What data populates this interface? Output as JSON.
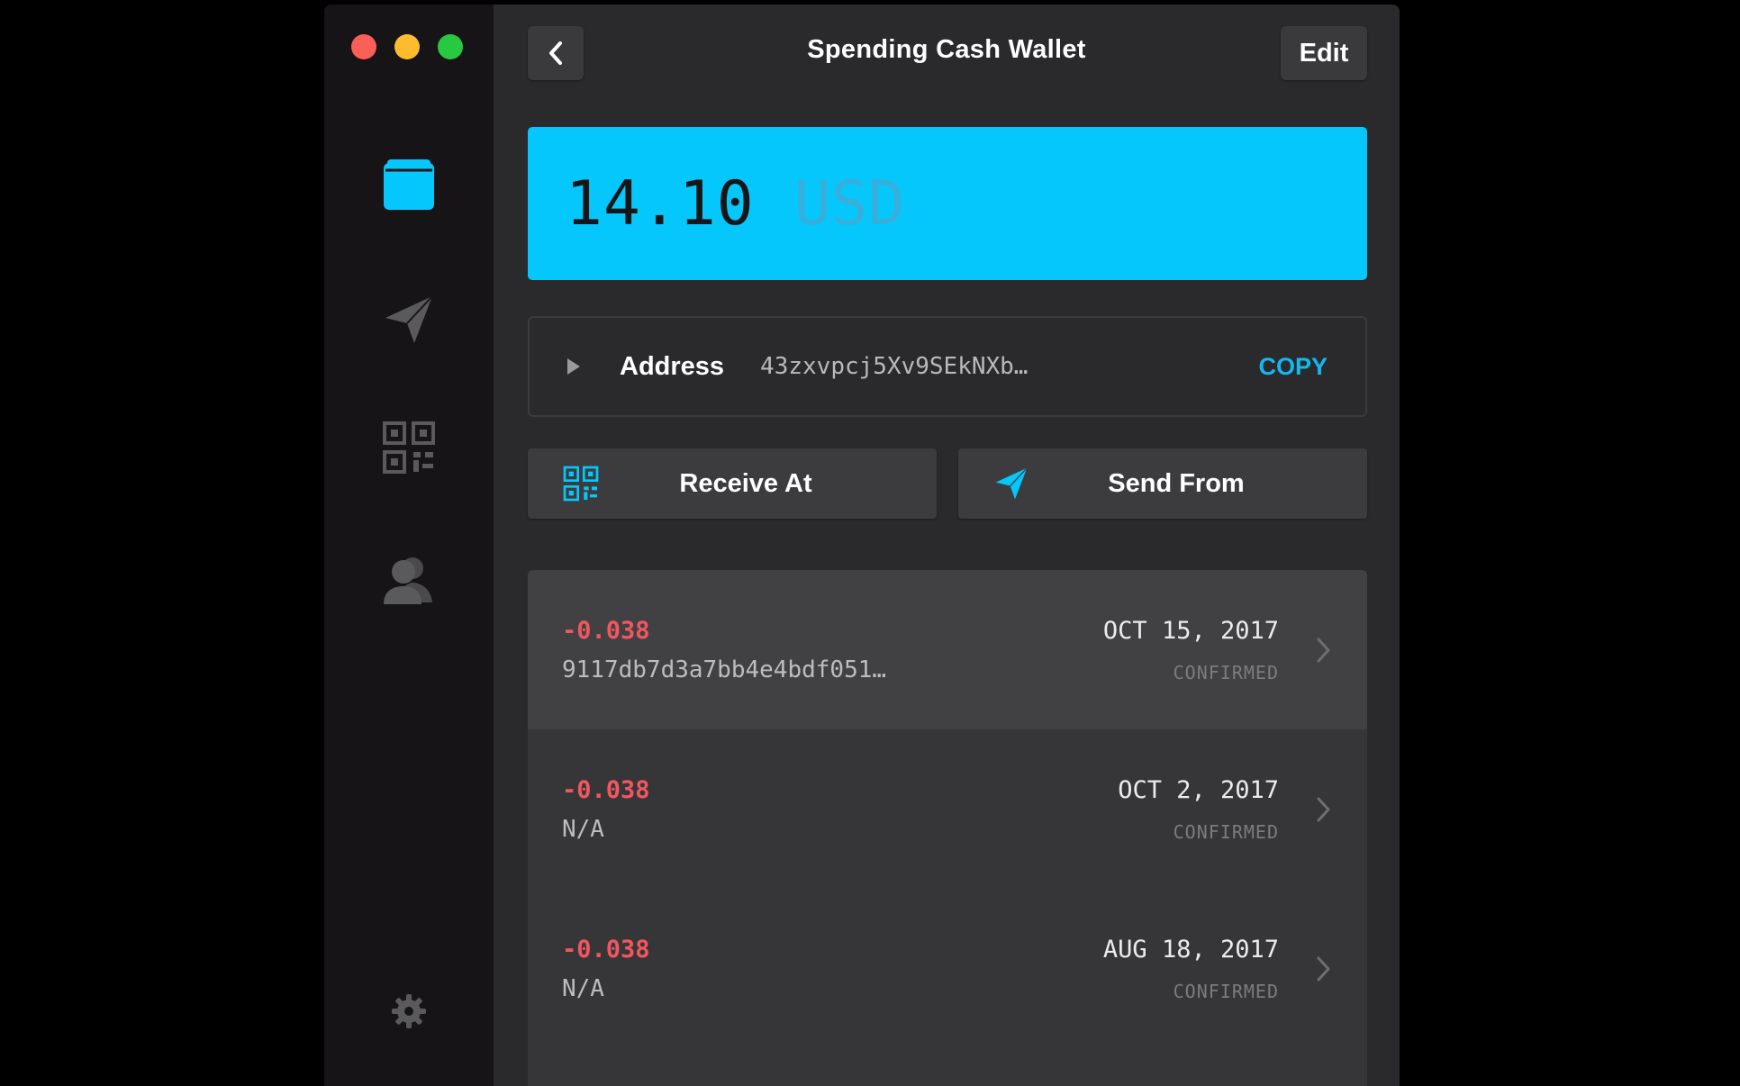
{
  "window": {
    "title": "Spending Cash Wallet",
    "edit_label": "Edit"
  },
  "sidebar": {
    "items": [
      {
        "name": "wallet",
        "icon": "wallet-icon",
        "active": true
      },
      {
        "name": "send",
        "icon": "paper-plane-icon"
      },
      {
        "name": "receive",
        "icon": "qr-code-icon"
      },
      {
        "name": "contacts",
        "icon": "contacts-icon"
      }
    ],
    "settings_icon": "gear-icon"
  },
  "balance": {
    "amount": "14.10",
    "unit": "USD",
    "card_color": "#05c7fc"
  },
  "address": {
    "label": "Address",
    "value": "43zxvpcj5Xv9SEkNXb…",
    "copy_label": "COPY"
  },
  "actions": {
    "receive_label": "Receive At",
    "send_label": "Send From"
  },
  "transactions": [
    {
      "amount": "-0.038",
      "hash": "9117db7d3a7bb4e4bdf051…",
      "date": "OCT 15, 2017",
      "status": "CONFIRMED"
    },
    {
      "amount": "-0.038",
      "hash": "N/A",
      "date": "OCT 2, 2017",
      "status": "CONFIRMED"
    },
    {
      "amount": "-0.038",
      "hash": "N/A",
      "date": "AUG 18, 2017",
      "status": "CONFIRMED"
    }
  ],
  "colors": {
    "accent": "#05c7fc",
    "negative": "#f2565f"
  }
}
